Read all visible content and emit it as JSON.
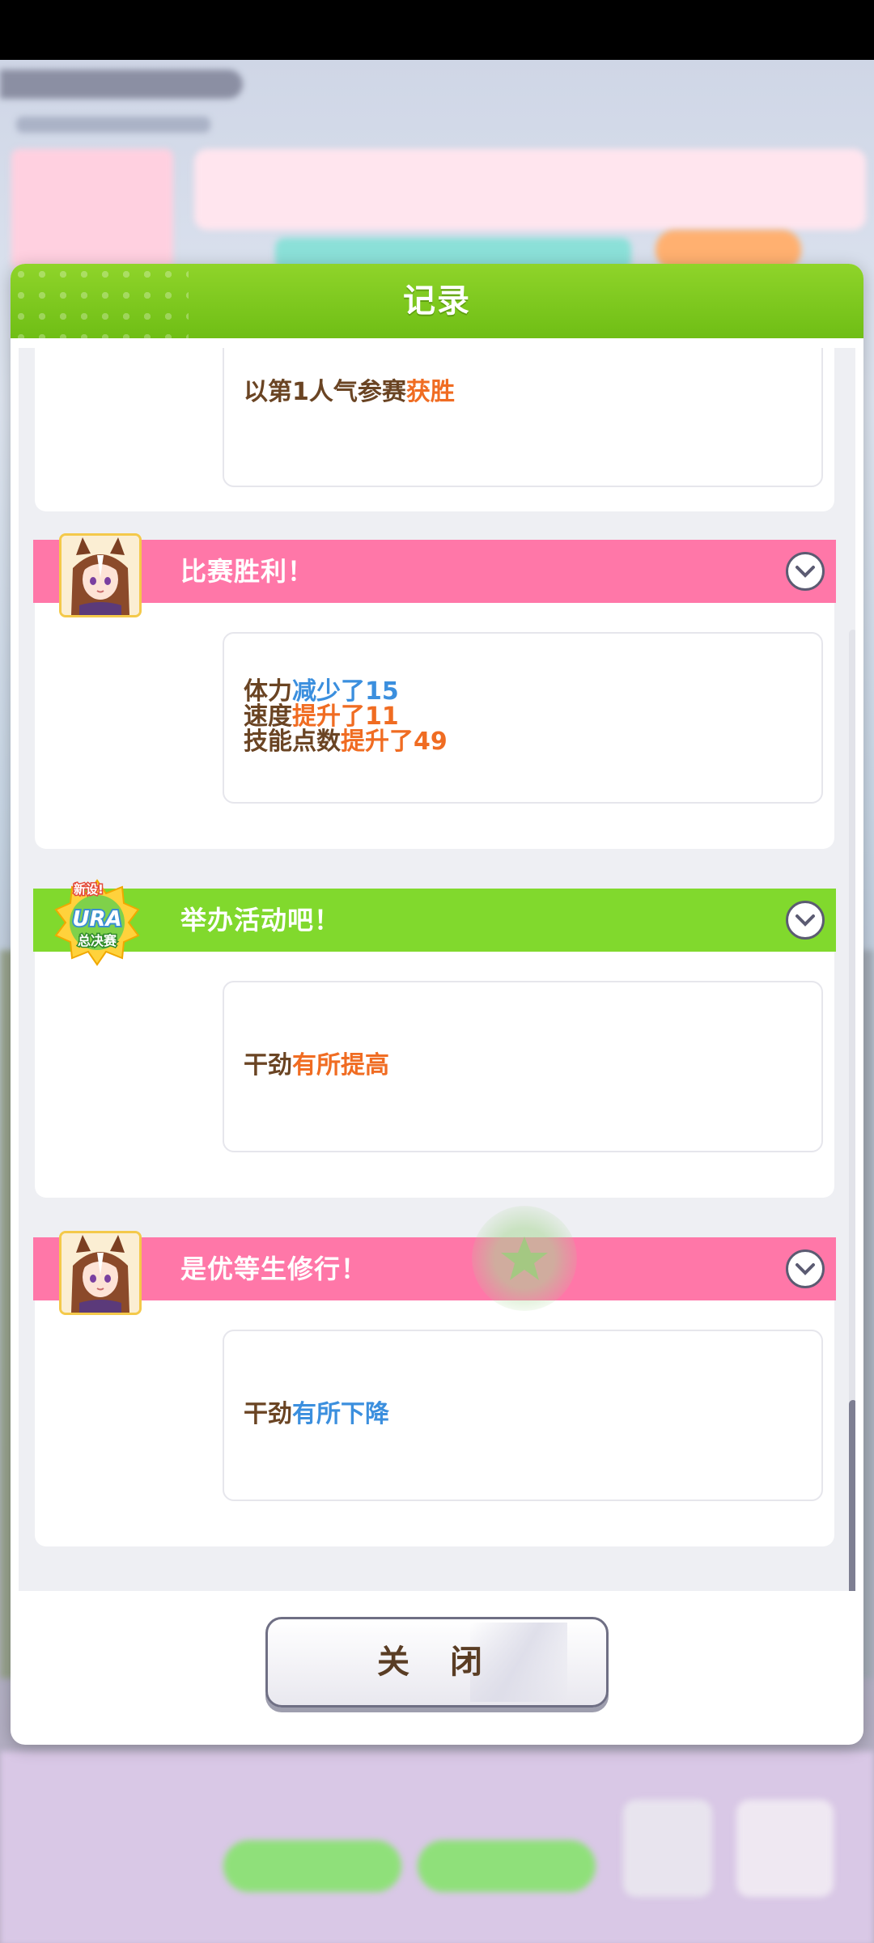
{
  "dialog": {
    "title": "记录",
    "close_label": "关 闭"
  },
  "entries": [
    {
      "title": "",
      "lines": [
        [
          {
            "text": "以第1人气参赛",
            "color": "brown"
          },
          {
            "text": "获胜",
            "color": "orange"
          }
        ]
      ]
    },
    {
      "title": "比赛胜利！",
      "header_color": "pink",
      "icon": "character-portrait",
      "lines": [
        [
          {
            "text": "体力",
            "color": "brown"
          },
          {
            "text": "减少了15",
            "color": "blue"
          }
        ],
        [
          {
            "text": "速度",
            "color": "brown"
          },
          {
            "text": "提升了11",
            "color": "orange"
          }
        ],
        [
          {
            "text": "技能点数",
            "color": "brown"
          },
          {
            "text": "提升了49",
            "color": "orange"
          }
        ]
      ]
    },
    {
      "title": "举办活动吧！",
      "header_color": "green",
      "icon": "ura-finals-badge",
      "badge_text": {
        "top": "新设!",
        "middle": "URA",
        "bottom": "总决赛"
      },
      "lines": [
        [
          {
            "text": "干劲",
            "color": "brown"
          },
          {
            "text": "有所提高",
            "color": "orange"
          }
        ]
      ]
    },
    {
      "title": "是优等生修行！",
      "header_color": "pink",
      "icon": "character-portrait",
      "lines": [
        [
          {
            "text": "干劲",
            "color": "brown"
          },
          {
            "text": "有所下降",
            "color": "blue"
          }
        ]
      ]
    }
  ],
  "colors": {
    "header_green": "#81d92d",
    "header_pink": "#ff77a8",
    "text_brown": "#6a4423",
    "text_orange": "#f06c22",
    "text_blue": "#3b8fde"
  }
}
